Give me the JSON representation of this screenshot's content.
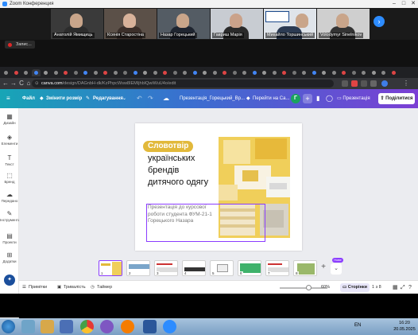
{
  "zoom": {
    "title": "Zoom Конференция",
    "record_label": "Запис...",
    "participants": [
      {
        "name": "Анатолій Ямищиць"
      },
      {
        "name": "Ксенія Старостіна"
      },
      {
        "name": "Назар Горецький"
      },
      {
        "name": "Гавриш Марія"
      },
      {
        "name": "Михайло Торшинський"
      },
      {
        "name": "Volodymyr Sinelnikov"
      }
    ],
    "next_icon": "chevron-right"
  },
  "browser": {
    "url_host": "canva.com",
    "url_path": "/design/DAGnbH-dk/KzPhpcWsw8IEMIjhbIQwiWuU4o/edit",
    "back": "←",
    "forward": "→",
    "reload": "C",
    "home": "⌂"
  },
  "canva": {
    "file_label": "Файл",
    "resize_label": "Змінити розмір",
    "edit_label": "Редагування",
    "doc_title": "Презентація_Горецький_Вр...",
    "goto_label": "Перейти на Ca...",
    "avatar_letter": "Г",
    "present_label": "Презентація",
    "share_label": "Поділитися",
    "rail": [
      {
        "icon": "▦",
        "label": "Дизайн"
      },
      {
        "icon": "◈",
        "label": "Елементи"
      },
      {
        "icon": "T",
        "label": "Текст"
      },
      {
        "icon": "⬚",
        "label": "Бренд"
      },
      {
        "icon": "☁",
        "label": "Передано"
      },
      {
        "icon": "✎",
        "label": "Інструменти"
      },
      {
        "icon": "▤",
        "label": "Проекти"
      },
      {
        "icon": "⊞",
        "label": "Додатки"
      }
    ]
  },
  "slide": {
    "badge": "Словотвір",
    "title": "українських брендів дитячого одягу",
    "subtitle": "Презентація до курсової роботи студента ФУМ-21-1 Горецького Назара"
  },
  "thumbnails": [
    {
      "n": "1"
    },
    {
      "n": "2"
    },
    {
      "n": "3"
    },
    {
      "n": "4"
    },
    {
      "n": "5"
    },
    {
      "n": "6"
    },
    {
      "n": "7"
    },
    {
      "n": "8"
    }
  ],
  "new_badge": "Нове",
  "bottom": {
    "notes": "Примітки",
    "duration": "Тривалість",
    "timer": "Таймер",
    "zoom_level": "60%",
    "zoom_fraction": 0.6,
    "pages": "Сторінки",
    "page_count": "1 з 8"
  },
  "taskbar": {
    "lang": "EN",
    "time": "16:20",
    "date": "20.05.2025"
  },
  "colors": {
    "accent_purple": "#8b3dff",
    "zoom_blue": "#2d8cff",
    "badge_gold": "#e2b93b"
  }
}
